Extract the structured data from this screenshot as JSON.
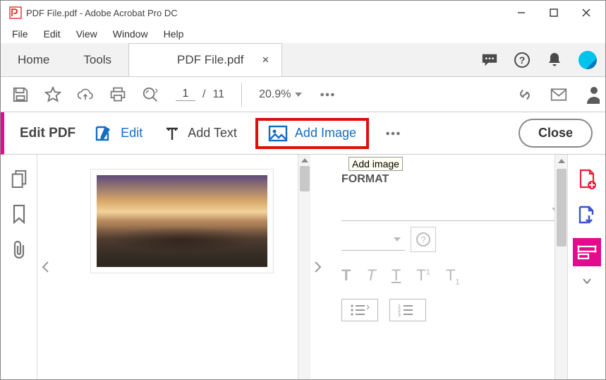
{
  "window": {
    "title": "PDF File.pdf - Adobe Acrobat Pro DC"
  },
  "menu": [
    "File",
    "Edit",
    "View",
    "Window",
    "Help"
  ],
  "tabs": {
    "home": "Home",
    "tools": "Tools",
    "doc": "PDF File.pdf"
  },
  "toolbar": {
    "current_page": "1",
    "total_pages": "11",
    "zoom": "20.9%"
  },
  "editbar": {
    "title": "Edit PDF",
    "edit": "Edit",
    "add_text": "Add Text",
    "add_image": "Add Image",
    "close": "Close"
  },
  "tooltip": "Add image",
  "panel": {
    "heading": "FORMAT"
  },
  "colors": {
    "accent_pink": "#e20c8d",
    "link_blue": "#146dc2",
    "highlight_red": "#e10c0c"
  }
}
